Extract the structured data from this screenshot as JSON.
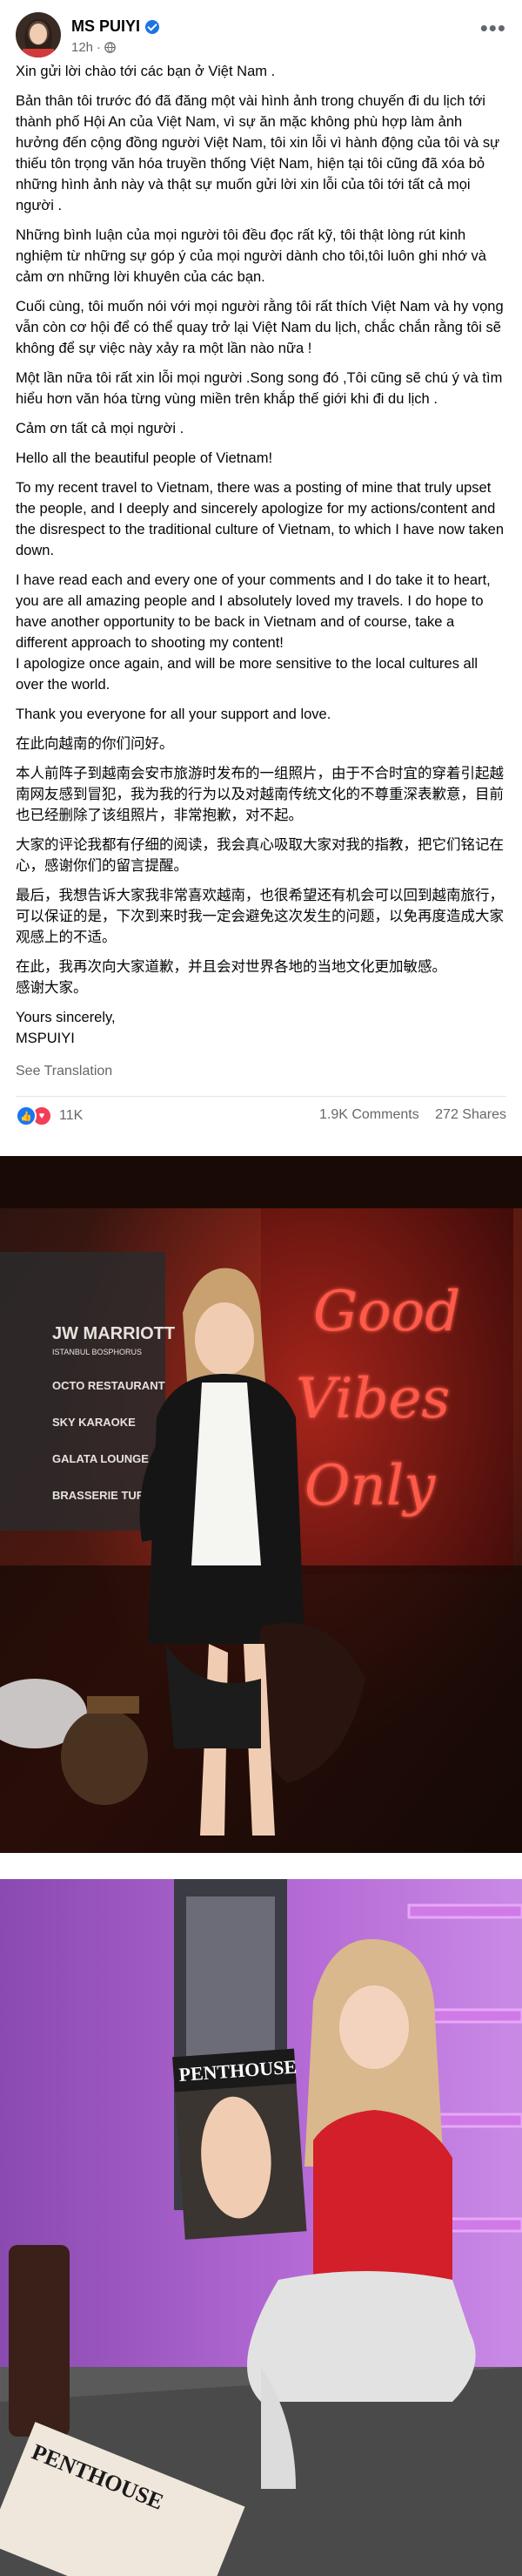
{
  "post": {
    "author": "MS PUIYI",
    "time": "12h",
    "privacy_separator": "·",
    "paragraphs": [
      "Xin gửi lời chào tới các bạn ở Việt Nam .",
      "Bản thân tôi trước đó đã đăng một vài hình ảnh trong chuyến đi du lịch tới thành phố Hội An của Việt Nam, vì sự ăn mặc không phù hợp làm ảnh hưởng  đến cộng đồng người Việt Nam, tôi xin lỗi vì hành động của tôi và sự thiếu tôn trọng văn hóa truyền thống Việt Nam, hiện tại tôi cũng đã xóa bỏ những hình ảnh này và thật sự muốn gửi lời xin lỗi của tôi tới tất cả mọi người .",
      "Những bình luận của mọi người tôi đều đọc rất kỹ, tôi  thật lòng rút kinh nghiệm từ những sự góp ý của  mọi người dành cho tôi,tôi luôn ghi nhớ và cảm ơn những lời khuyên của các bạn.",
      "Cuối cùng, tôi muốn nói với mọi người rằng tôi rất thích Việt Nam và hy vọng vẫn còn cơ hội để có thể quay trở lại Việt Nam du lịch, chắc chắn rằng tôi sẽ không để sự việc này xảy ra một lần nào nữa !",
      " Một lần nữa tôi rất xin lỗi mọi người .Song song đó ,Tôi cũng sẽ chú ý và tìm hiểu hơn văn hóa từng vùng miền  trên khắp thế giới khi đi du lịch .",
      "Cảm ơn tất cả mọi người .",
      "Hello all the beautiful people of Vietnam!",
      "To my recent travel to Vietnam, there was a posting of mine that truly upset the people, and I deeply and sincerely apologize for my actions/content and the disrespect to the traditional culture of Vietnam, to which I have now taken down.",
      "I have read each and every one of your comments and I do take it to heart, you are all amazing people and I absolutely loved my travels. I do hope to have another opportunity to be back in Vietnam and of course, take a different approach to shooting my content!\nI apologize once again, and will be more sensitive to the local cultures all over the world.",
      "Thank you everyone for all your support and love.",
      "在此向越南的你们问好。",
      "本人前阵子到越南会安市旅游时发布的一组照片，由于不合时宜的穿着引起越南网友感到冒犯，我为我的行为以及对越南传统文化的不尊重深表歉意，目前也已经删除了该组照片，非常抱歉，对不起。",
      "大家的评论我都有仔细的阅读，我会真心吸取大家对我的指教，把它们铭记在心，感谢你们的留言提醒。",
      "最后，我想告诉大家我非常喜欢越南，也很希望还有机会可以回到越南旅行，可以保证的是，下次到来时我一定会避免这次发生的问题，以免再度造成大家观感上的不适。",
      "在此，我再次向大家道歉，并且会对世界各地的当地文化更加敏感。\n 感谢大家。",
      "Yours sincerely,\nMSPUIYI"
    ],
    "see_translation": "See Translation",
    "reaction_count": "11K",
    "comments": "1.9K Comments",
    "shares": "272 Shares",
    "more_icon": "more-horizontal-icon",
    "globe_icon": "globe-icon",
    "reactions_icons": [
      "like-icon",
      "love-icon"
    ]
  },
  "photos": {
    "photo1": {
      "neon_lines": [
        "Good",
        "Vibes",
        "Only"
      ],
      "sign_items": [
        "JW MARRIOTT",
        "ISTANBUL BOSPHORUS",
        "OCTO RESTAURANT",
        "SKY KARAOKE",
        "GALATA LOUNGE",
        "BRASSERIE TURQUOISE"
      ]
    },
    "photo2": {
      "magazine_title": "PENTHOUSE",
      "table_magazine": "PENTHOUSE"
    }
  },
  "colors": {
    "fb_blue": "#1877f2",
    "neon_red": "#ff2a2a",
    "purple_wall": "#b66bd6"
  }
}
